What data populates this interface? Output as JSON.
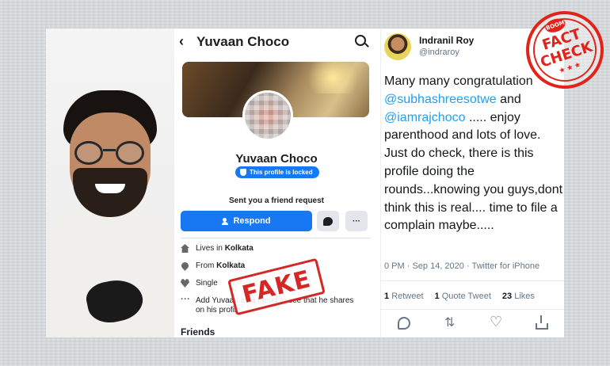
{
  "facebook": {
    "title": "Yuvaan Choco",
    "profile_name": "Yuvaan Choco",
    "locked_badge": "This profile is locked",
    "request_text": "Sent you a friend request",
    "respond_label": "Respond",
    "more_label": "···",
    "info": [
      {
        "icon": "home-icon",
        "prefix": "Lives in ",
        "bold": "Kolkata",
        "suffix": ""
      },
      {
        "icon": "location-pin-icon",
        "prefix": "From ",
        "bold": "Kolkata",
        "suffix": ""
      },
      {
        "icon": "heart-icon",
        "prefix": "Single",
        "bold": "",
        "suffix": ""
      },
      {
        "icon": "more-dots-icon",
        "prefix": "Add Yuvaan as a friend to see",
        "bold": "",
        "suffix": "that he shares on his profile"
      }
    ],
    "friends_heading": "Friends"
  },
  "fake_stamp": "FAKE",
  "tweet": {
    "name": "Indranil Roy",
    "handle": "@indraroy",
    "text_1": "Many many congratulation",
    "mention_1": "@subhashreesotwe",
    "text_2": " and",
    "mention_2": "@iamrajchoco",
    "text_3": " ..... enjoy parenthood and lots of love. Just do check, there is this profile doing the rounds...knowing you guys,dont think this is real.... time to file a complain maybe.....",
    "meta": "0 PM · Sep 14, 2020 · Twitter for iPhone",
    "retweets_count": "1",
    "retweets_label": "Retweet",
    "quotes_count": "1",
    "quotes_label": "Quote Tweet",
    "likes_count": "23",
    "likes_label": "Likes"
  },
  "fact_check_stamp": {
    "badge": "BOOM",
    "line1": "FACT",
    "line2": "CHECK",
    "stars": "★★★"
  },
  "colors": {
    "facebook_blue": "#1877f2",
    "twitter_link": "#1da1f2",
    "stamp_red": "#d62626"
  }
}
